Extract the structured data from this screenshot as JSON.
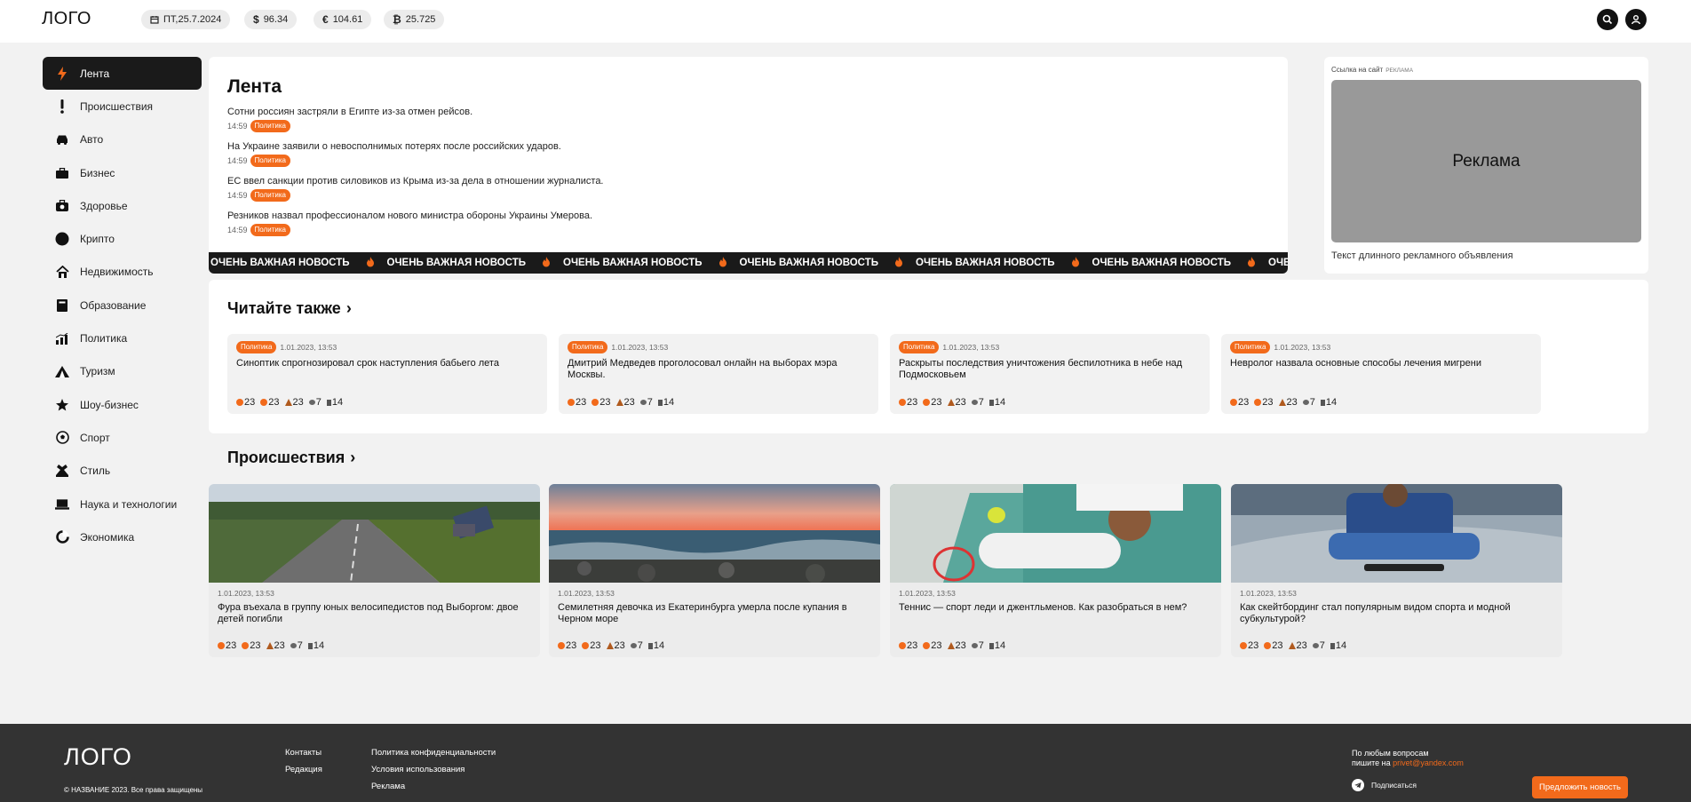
{
  "header": {
    "logo": "ЛОГО",
    "date": "ПТ,25.7.2024",
    "usd_symbol": "$",
    "usd": "96.34",
    "eur_symbol": "€",
    "eur": "104.61",
    "btc_symbol": "₿",
    "btc": "25.725"
  },
  "sidebar": {
    "items": [
      {
        "label": "Лента",
        "icon": "lightning-icon"
      },
      {
        "label": "Происшествия",
        "icon": "exclamation-icon"
      },
      {
        "label": "Авто",
        "icon": "car-icon"
      },
      {
        "label": "Бизнес",
        "icon": "briefcase-icon"
      },
      {
        "label": "Здоровье",
        "icon": "medkit-icon"
      },
      {
        "label": "Крипто",
        "icon": "crypto-icon"
      },
      {
        "label": "Недвижимость",
        "icon": "house-icon"
      },
      {
        "label": "Образование",
        "icon": "book-icon"
      },
      {
        "label": "Политика",
        "icon": "chart-icon"
      },
      {
        "label": "Туризм",
        "icon": "tent-icon"
      },
      {
        "label": "Шоу-бизнес",
        "icon": "star-icon"
      },
      {
        "label": "Спорт",
        "icon": "ball-icon"
      },
      {
        "label": "Стиль",
        "icon": "style-icon"
      },
      {
        "label": "Наука и технологии",
        "icon": "laptop-icon"
      },
      {
        "label": "Экономика",
        "icon": "pie-icon"
      }
    ]
  },
  "feed": {
    "title": "Лента",
    "items": [
      {
        "title": "Сотни россиян застряли в Египте из-за отмен рейсов.",
        "time": "14:59",
        "tag": "Политика"
      },
      {
        "title": "На Украине заявили о невосполнимых потерях после российских ударов.",
        "time": "14:59",
        "tag": "Политика"
      },
      {
        "title": "ЕС ввел санкции против силовиков из Крыма из-за дела в отношении журналиста.",
        "time": "14:59",
        "tag": "Политика"
      },
      {
        "title": "Резников назвал профессионалом нового министра обороны Украины Умерова.",
        "time": "14:59",
        "tag": "Политика"
      }
    ],
    "ticker": "ОЧЕНЬ ВАЖНАЯ НОВОСТЬ"
  },
  "ad": {
    "caption": "Ссылка на сайт",
    "caption_sub": "РЕКЛАМА",
    "box_text": "Реклама",
    "text": "Текст длинного рекламного объявления"
  },
  "read_also": {
    "title": "Читайте также",
    "chevron": "›",
    "cards": [
      {
        "tag": "Политика",
        "date": "1.01.2023, 13:53",
        "title": "Синоптик спрогнозировал срок наступления бабьего лета",
        "s1": "23",
        "s2": "23",
        "s3": "23",
        "s4": "7",
        "s5": "14"
      },
      {
        "tag": "Политика",
        "date": "1.01.2023, 13:53",
        "title": "Дмитрий Медведев проголосовал онлайн на выборах мэра Москвы.",
        "s1": "23",
        "s2": "23",
        "s3": "23",
        "s4": "7",
        "s5": "14"
      },
      {
        "tag": "Политика",
        "date": "1.01.2023, 13:53",
        "title": "Раскрыты последствия уничтожения беспилотника в небе над Подмосковьем",
        "s1": "23",
        "s2": "23",
        "s3": "23",
        "s4": "7",
        "s5": "14"
      },
      {
        "tag": "Политика",
        "date": "1.01.2023, 13:53",
        "title": "Невролог назвала основные способы лечения мигрени",
        "s1": "23",
        "s2": "23",
        "s3": "23",
        "s4": "7",
        "s5": "14"
      }
    ]
  },
  "incidents": {
    "title": "Происшествия",
    "chevron": "›",
    "cards": [
      {
        "date": "1.01.2023, 13:53",
        "title": "Фура въехала в группу юных велосипедистов под Выборгом: двое детей погибли",
        "s1": "23",
        "s2": "23",
        "s3": "23",
        "s4": "7",
        "s5": "14"
      },
      {
        "date": "1.01.2023, 13:53",
        "title": "Семилетняя девочка из Екатеринбурга умерла после купания в Черном море",
        "s1": "23",
        "s2": "23",
        "s3": "23",
        "s4": "7",
        "s5": "14"
      },
      {
        "date": "1.01.2023, 13:53",
        "title": "Теннис — спорт леди и джентльменов. Как разобраться в нем?",
        "s1": "23",
        "s2": "23",
        "s3": "23",
        "s4": "7",
        "s5": "14"
      },
      {
        "date": "1.01.2023, 13:53",
        "title": "Как скейтбординг стал популярным видом спорта и модной субкультурой?",
        "s1": "23",
        "s2": "23",
        "s3": "23",
        "s4": "7",
        "s5": "14"
      }
    ]
  },
  "footer": {
    "logo": "ЛОГО",
    "copyright": "© НАЗВАНИЕ 2023. Все права защищены",
    "contacts": "Контакты",
    "editorial": "Редакция",
    "privacy": "Политика конфиденциальности",
    "terms": "Условия использования",
    "ads": "Реклама",
    "question_line1": "По любым вопросам",
    "question_line2": "пишите на",
    "email": "privet@yandex.com",
    "subscribe": "Подписаться",
    "suggest": "Предложить новость"
  },
  "colors": {
    "accent": "#f26a1b",
    "dark": "#1a1a1a",
    "footer": "#333333"
  }
}
